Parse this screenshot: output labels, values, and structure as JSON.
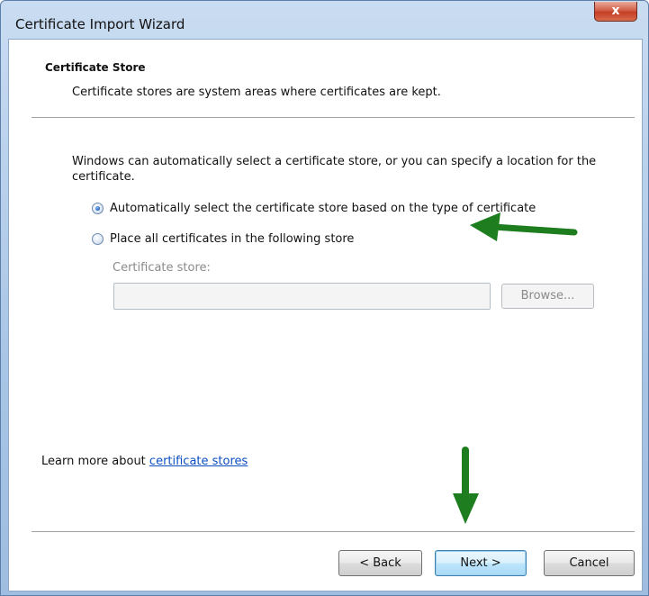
{
  "window": {
    "title": "Certificate Import Wizard",
    "close_label": "x"
  },
  "header": {
    "title": "Certificate Store",
    "subtitle": "Certificate stores are system areas where certificates are kept."
  },
  "body": {
    "intro": "Windows can automatically select a certificate store, or you can specify a location for the certificate.",
    "options": [
      {
        "label": "Automatically select the certificate store based on the type of certificate",
        "selected": true
      },
      {
        "label": "Place all certificates in the following store",
        "selected": false
      }
    ],
    "store_label": "Certificate store:",
    "store_value": "",
    "browse_label": "Browse..."
  },
  "footer": {
    "learn_prefix": "Learn more about ",
    "learn_link": "certificate stores",
    "back_label": "< Back",
    "next_label": "Next >",
    "cancel_label": "Cancel"
  },
  "colors": {
    "annotation_arrow": "#1e7d1e",
    "link": "#0b4fc4"
  }
}
